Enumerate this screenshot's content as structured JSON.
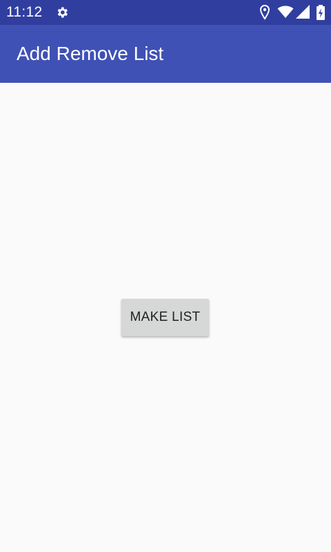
{
  "status_bar": {
    "time": "11:12",
    "background": "#303f9f",
    "icons": [
      "gear-icon",
      "location-icon",
      "wifi-icon",
      "signal-icon",
      "battery-icon"
    ]
  },
  "app_bar": {
    "title": "Add Remove List",
    "background": "#3f51b5"
  },
  "main": {
    "make_list_label": "MAKE LIST",
    "button_color": "#d6d7d7"
  }
}
